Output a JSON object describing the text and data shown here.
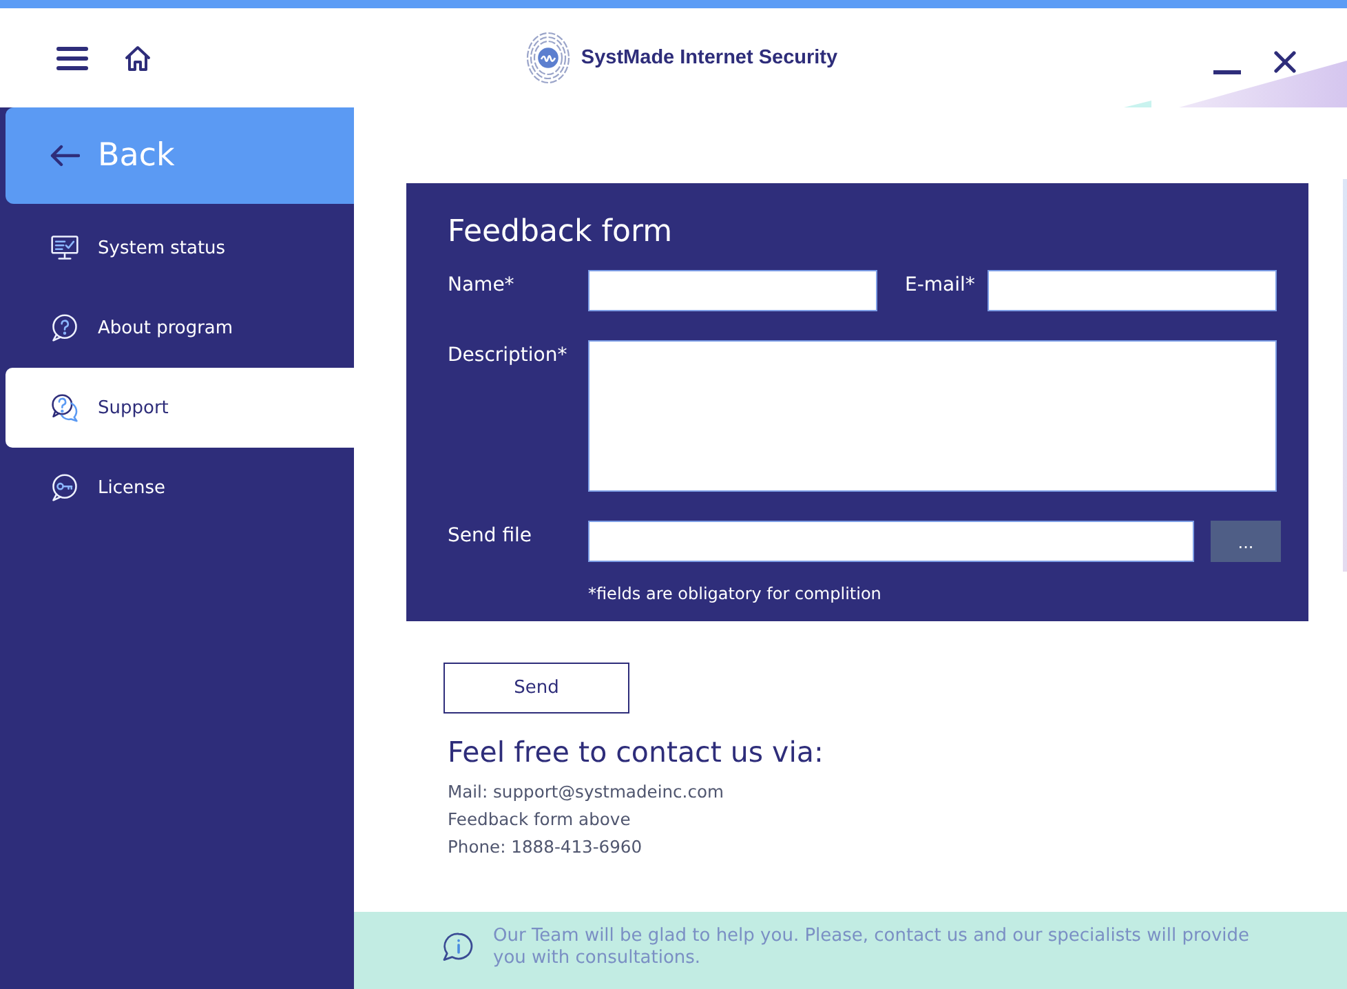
{
  "header": {
    "title": "SystMade Internet Security"
  },
  "sidebar": {
    "back": "Back",
    "items": [
      {
        "label": "System status",
        "selected": false
      },
      {
        "label": "About program",
        "selected": false
      },
      {
        "label": "Support",
        "selected": true
      },
      {
        "label": "License",
        "selected": false
      }
    ]
  },
  "feedback_form": {
    "title": "Feedback form",
    "rows": [
      {
        "fields": [
          {
            "kind": "text",
            "label": "Name*"
          },
          {
            "kind": "text",
            "label": "E-mail*"
          }
        ]
      },
      {
        "fields": [
          {
            "kind": "textarea",
            "label": "Description*"
          }
        ]
      },
      {
        "fields": [
          {
            "kind": "file",
            "label": "Send file",
            "button": "..."
          }
        ]
      }
    ],
    "note": "*fields are obligatory for complition"
  },
  "send_button": {
    "label": "Send"
  },
  "contact": {
    "title": "Feel free to contact us via:",
    "lines": [
      "Mail: support@systmadeinc.com",
      "Feedback form above",
      "Phone: 1888-413-6960"
    ]
  },
  "info_bar": {
    "text": "Our Team will be glad to help you. Please, contact us and our specialists will provide you with consultations."
  }
}
